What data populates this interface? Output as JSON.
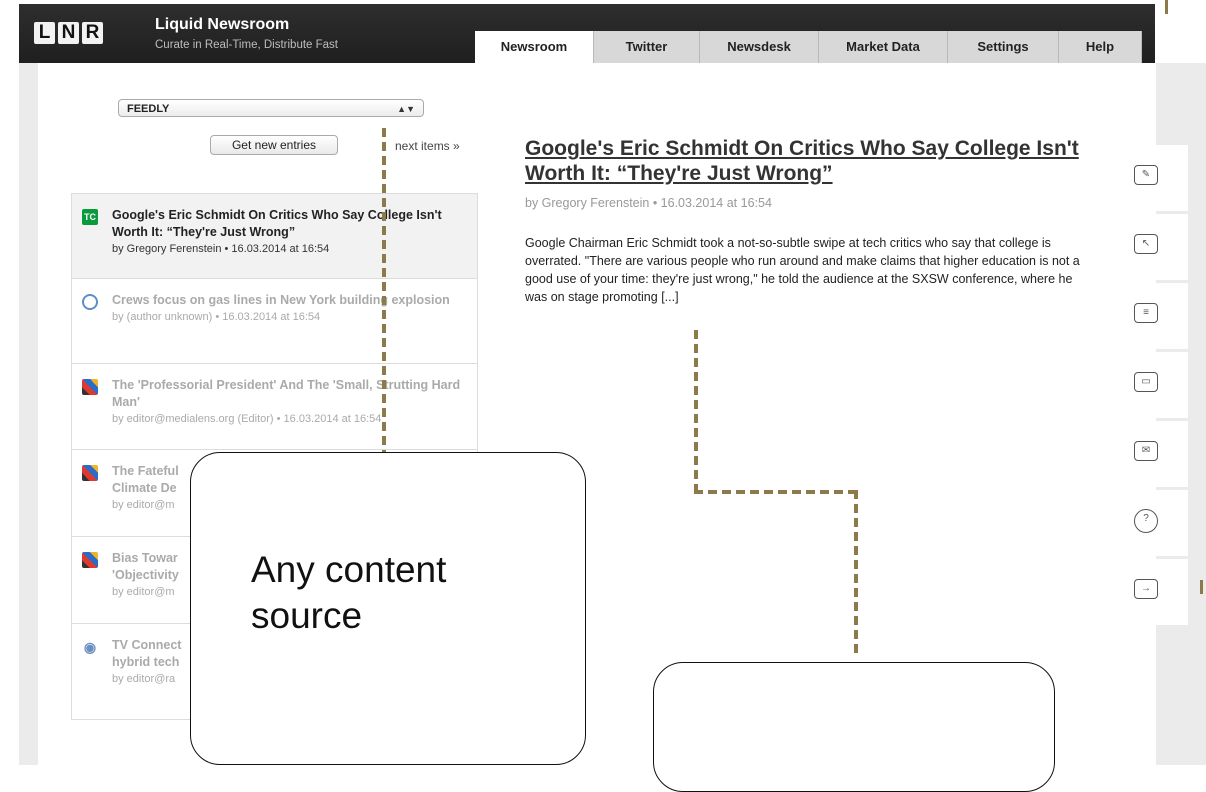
{
  "header": {
    "logo_letters": [
      "L",
      "N",
      "R"
    ],
    "title": "Liquid Newsroom",
    "subtitle": "Curate in Real-Time, Distribute Fast",
    "tabs": [
      {
        "label": "Newsroom",
        "active": true
      },
      {
        "label": "Twitter",
        "active": false
      },
      {
        "label": "Newsdesk",
        "active": false
      },
      {
        "label": "Market Data",
        "active": false
      },
      {
        "label": "Settings",
        "active": false
      },
      {
        "label": "Help",
        "active": false
      }
    ]
  },
  "sidebar": {
    "source_select": "FEEDLY",
    "get_entries_label": "Get new entries",
    "next_items_label": "next items »",
    "items": [
      {
        "icon": "techcrunch-icon",
        "title": "Google's Eric Schmidt On Critics Who Say College Isn't Worth It: “They're Just Wrong”",
        "meta": "by Gregory Ferenstein • 16.03.2014 at 16:54",
        "selected": true
      },
      {
        "icon": "globe-icon",
        "title": "Crews focus on gas lines in New York building explosion",
        "meta": "by (author unknown) • 16.03.2014 at 16:54",
        "selected": false
      },
      {
        "icon": "medialens-icon",
        "title": "The 'Professorial President' And The 'Small, Strutting Hard Man'",
        "meta": "by editor@medialens.org (Editor) • 16.03.2014 at 16:54",
        "selected": false
      },
      {
        "icon": "medialens-icon",
        "title": "The Fateful",
        "title2": "Climate De",
        "meta": "by editor@m",
        "selected": false
      },
      {
        "icon": "medialens-icon",
        "title": "Bias Towar",
        "title2": "'Objectivity",
        "meta": "by editor@m",
        "selected": false
      },
      {
        "icon": "radio-icon",
        "title": "TV Connect",
        "title2": "hybrid tech",
        "meta": "by editor@ra",
        "selected": false
      }
    ]
  },
  "article": {
    "title": "Google's Eric Schmidt On Critics Who Say College Isn't Worth It: “They're Just Wrong”",
    "meta": "by Gregory Ferenstein • 16.03.2014 at 16:54",
    "body": "Google Chairman Eric Schmidt took a not-so-subtle swipe at tech critics who say that college is overrated. \"There are various people who run around and make claims that higher education is not a good use of your time: they're just wrong,\" he told the audience at the SXSW conference, where he was on stage promoting [...]"
  },
  "actions": [
    {
      "icon": "edit-comment-icon"
    },
    {
      "icon": "pointer-comment-icon"
    },
    {
      "icon": "list-edit-comment-icon"
    },
    {
      "icon": "image-comment-icon"
    },
    {
      "icon": "email-send-icon"
    },
    {
      "icon": "help-icon",
      "glyph": "?"
    },
    {
      "icon": "logout-icon",
      "glyph": "→"
    }
  ],
  "annotations": {
    "callout_left": "Any content source",
    "callout_left_line1": "Any content",
    "callout_left_line2": "source",
    "callout_right": ""
  }
}
